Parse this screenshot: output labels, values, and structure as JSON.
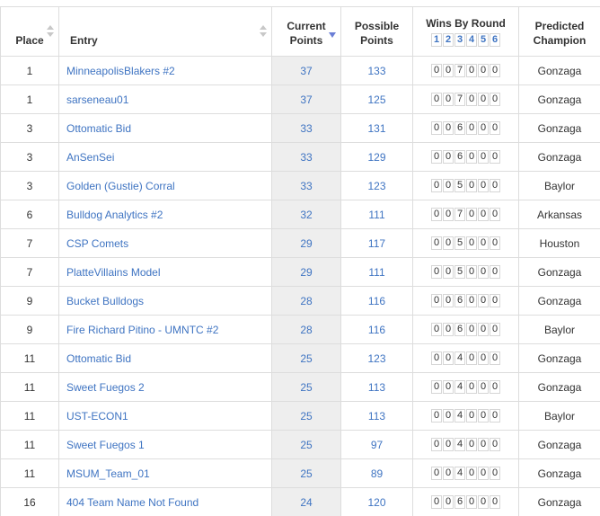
{
  "headers": {
    "place": "Place",
    "entry": "Entry",
    "current_points": [
      "Current",
      "Points"
    ],
    "possible_points": [
      "Possible",
      "Points"
    ],
    "wins_by_round": "Wins By Round",
    "rounds": [
      "1",
      "2",
      "3",
      "4",
      "5",
      "6"
    ],
    "predicted_champion": [
      "Predicted",
      "Champion"
    ]
  },
  "colors": {
    "link": "#3f74c2",
    "sort_active": "#6b7fd6",
    "current_col_bg": "#eeeeee"
  },
  "rows": [
    {
      "place": "1",
      "entry": "MinneapolisBlakers #2",
      "current": "37",
      "possible": "133",
      "wins": [
        "0",
        "0",
        "7",
        "0",
        "0",
        "0"
      ],
      "champion": "Gonzaga"
    },
    {
      "place": "1",
      "entry": "sarseneau01",
      "current": "37",
      "possible": "125",
      "wins": [
        "0",
        "0",
        "7",
        "0",
        "0",
        "0"
      ],
      "champion": "Gonzaga"
    },
    {
      "place": "3",
      "entry": "Ottomatic Bid",
      "current": "33",
      "possible": "131",
      "wins": [
        "0",
        "0",
        "6",
        "0",
        "0",
        "0"
      ],
      "champion": "Gonzaga"
    },
    {
      "place": "3",
      "entry": "AnSenSei",
      "current": "33",
      "possible": "129",
      "wins": [
        "0",
        "0",
        "6",
        "0",
        "0",
        "0"
      ],
      "champion": "Gonzaga"
    },
    {
      "place": "3",
      "entry": "Golden (Gustie) Corral",
      "current": "33",
      "possible": "123",
      "wins": [
        "0",
        "0",
        "5",
        "0",
        "0",
        "0"
      ],
      "champion": "Baylor"
    },
    {
      "place": "6",
      "entry": "Bulldog Analytics #2",
      "current": "32",
      "possible": "111",
      "wins": [
        "0",
        "0",
        "7",
        "0",
        "0",
        "0"
      ],
      "champion": "Arkansas"
    },
    {
      "place": "7",
      "entry": "CSP Comets",
      "current": "29",
      "possible": "117",
      "wins": [
        "0",
        "0",
        "5",
        "0",
        "0",
        "0"
      ],
      "champion": "Houston"
    },
    {
      "place": "7",
      "entry": "PlatteVillains Model",
      "current": "29",
      "possible": "111",
      "wins": [
        "0",
        "0",
        "5",
        "0",
        "0",
        "0"
      ],
      "champion": "Gonzaga"
    },
    {
      "place": "9",
      "entry": "Bucket Bulldogs",
      "current": "28",
      "possible": "116",
      "wins": [
        "0",
        "0",
        "6",
        "0",
        "0",
        "0"
      ],
      "champion": "Gonzaga"
    },
    {
      "place": "9",
      "entry": "Fire Richard Pitino - UMNTC #2",
      "current": "28",
      "possible": "116",
      "wins": [
        "0",
        "0",
        "6",
        "0",
        "0",
        "0"
      ],
      "champion": "Baylor"
    },
    {
      "place": "11",
      "entry": "Ottomatic Bid",
      "current": "25",
      "possible": "123",
      "wins": [
        "0",
        "0",
        "4",
        "0",
        "0",
        "0"
      ],
      "champion": "Gonzaga"
    },
    {
      "place": "11",
      "entry": "Sweet Fuegos 2",
      "current": "25",
      "possible": "113",
      "wins": [
        "0",
        "0",
        "4",
        "0",
        "0",
        "0"
      ],
      "champion": "Gonzaga"
    },
    {
      "place": "11",
      "entry": "UST-ECON1",
      "current": "25",
      "possible": "113",
      "wins": [
        "0",
        "0",
        "4",
        "0",
        "0",
        "0"
      ],
      "champion": "Baylor"
    },
    {
      "place": "11",
      "entry": "Sweet Fuegos 1",
      "current": "25",
      "possible": "97",
      "wins": [
        "0",
        "0",
        "4",
        "0",
        "0",
        "0"
      ],
      "champion": "Gonzaga"
    },
    {
      "place": "11",
      "entry": "MSUM_Team_01",
      "current": "25",
      "possible": "89",
      "wins": [
        "0",
        "0",
        "4",
        "0",
        "0",
        "0"
      ],
      "champion": "Gonzaga"
    },
    {
      "place": "16",
      "entry": "404 Team Name Not Found",
      "current": "24",
      "possible": "120",
      "wins": [
        "0",
        "0",
        "6",
        "0",
        "0",
        "0"
      ],
      "champion": "Gonzaga"
    }
  ]
}
